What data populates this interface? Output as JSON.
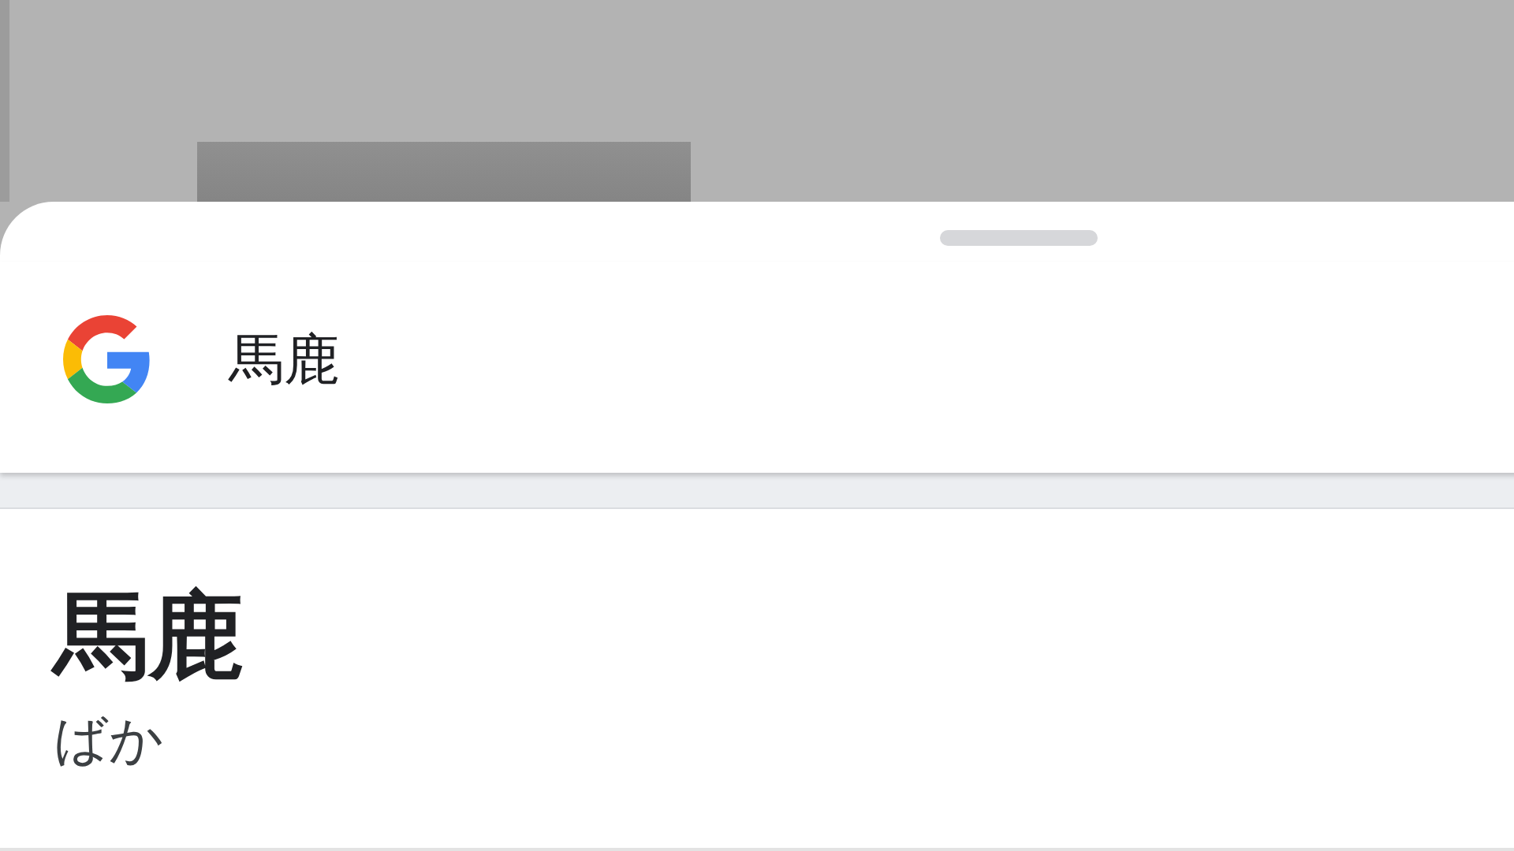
{
  "search_bar": {
    "query": "馬鹿"
  },
  "result": {
    "word": "馬鹿",
    "reading": "ばか"
  }
}
